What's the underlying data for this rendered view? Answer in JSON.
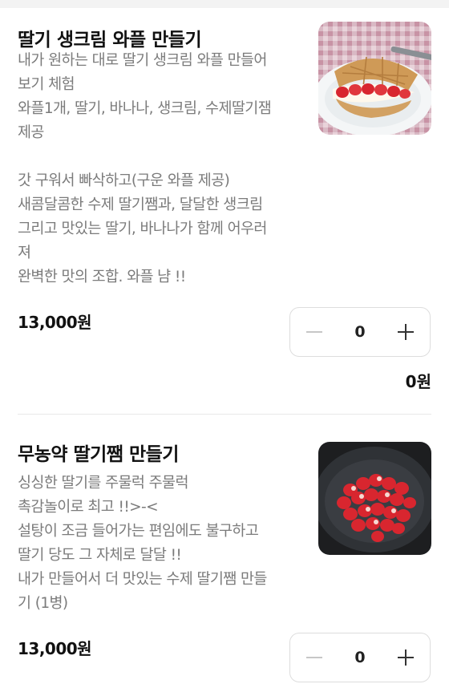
{
  "products": [
    {
      "title": "딸기 생크림 와플 만들기",
      "description": "내가 원하는 대로 딸기 생크림 와플 만들어\n보기 체험\n와플1개, 딸기, 바나나, 생크림, 수제딸기잼\n제공\n\n갓 구워서 빠삭하고(구운 와플 제공)\n새콤달콤한 수제 딸기쨈과, 달달한 생크림\n그리고 맛있는 딸기, 바나나가 함께 어우러\n져\n완벽한 맛의 조합. 와플 냠 !!",
      "price": "13,000원",
      "quantity": "0",
      "total": "0원",
      "image_icon": "strawberry-waffle-photo"
    },
    {
      "title": "무농약 딸기쨈 만들기",
      "description": "싱싱한 딸기를 주물럭 주물럭\n촉감놀이로 최고 !!>-<\n설탕이 조금 들어가는 편임에도 불구하고\n딸기 당도 그 자체로 달달 !!\n내가 만들어서 더 맛있는 수제 딸기쨈 만들\n기 (1병)",
      "price": "13,000원",
      "quantity": "0",
      "image_icon": "strawberries-in-pan-photo"
    }
  ],
  "icons": {
    "minus": "minus-icon",
    "plus": "plus-icon"
  },
  "colors": {
    "text": "#111111",
    "muted": "#7b7b7b",
    "border": "#dddddd",
    "strawberry": "#d8262f"
  }
}
